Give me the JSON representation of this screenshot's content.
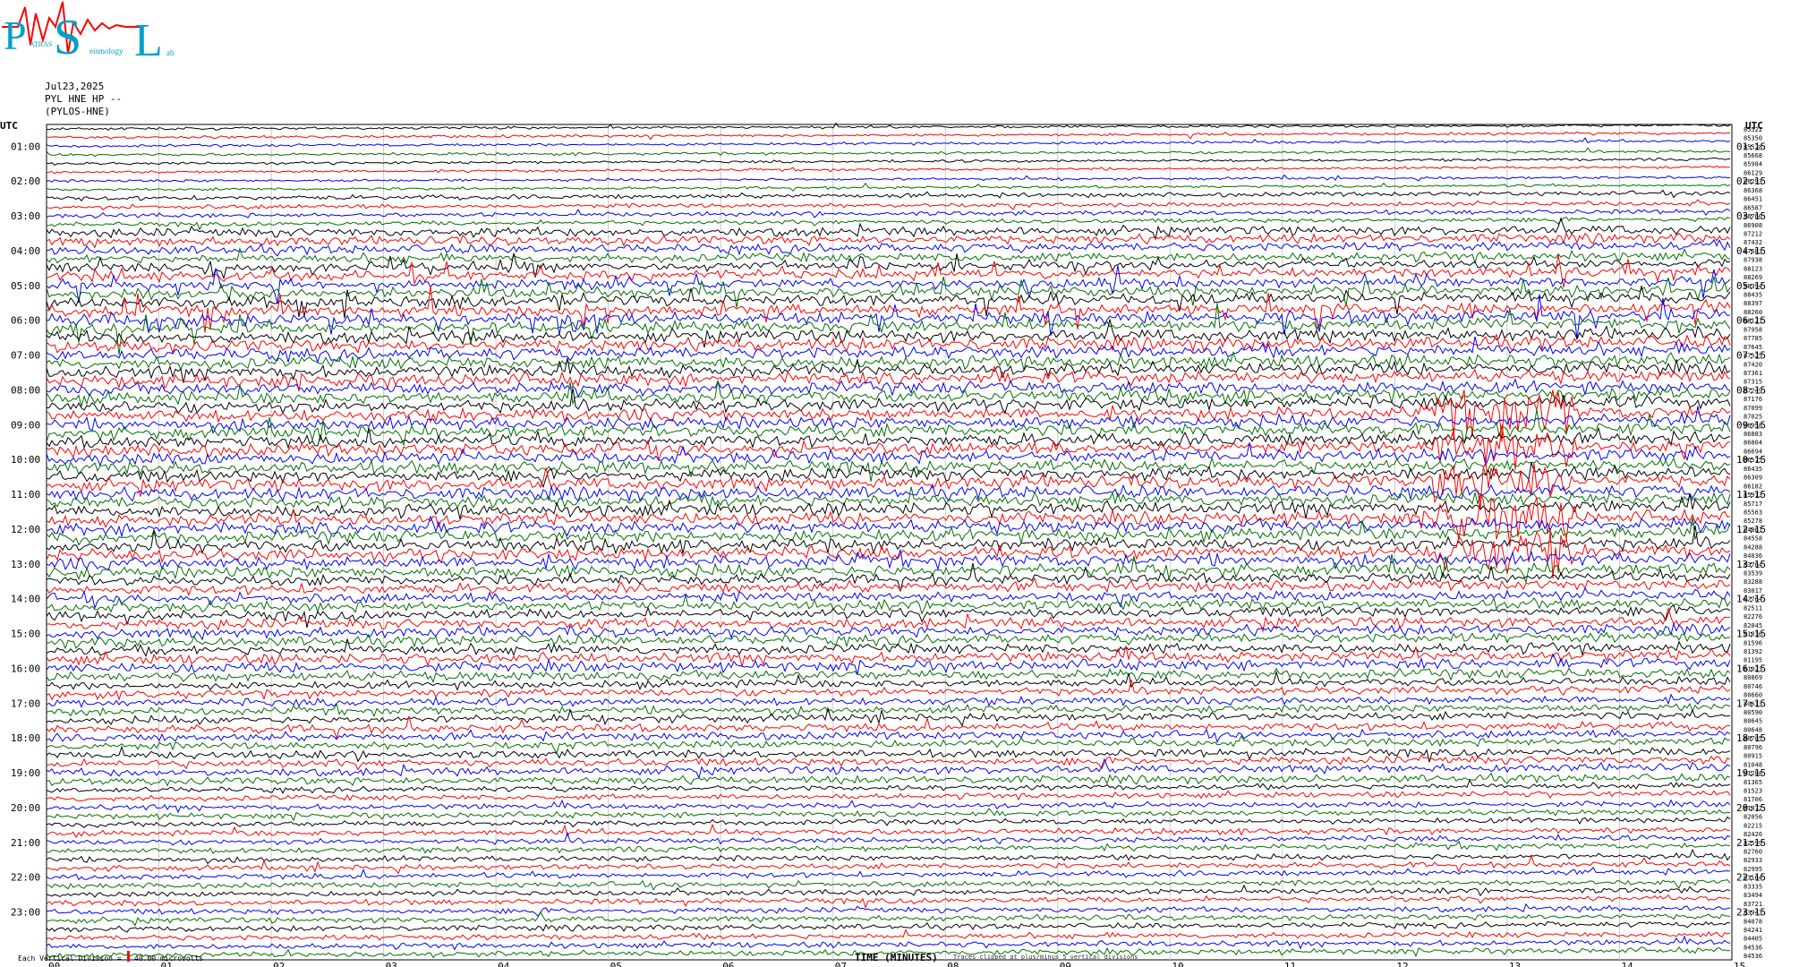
{
  "logo": {
    "text_p": "P",
    "text_s": "S",
    "text_l": "L",
    "subtext_1": "ATRAS",
    "subtext_2": "eismology",
    "subtext_3": "ab"
  },
  "header": {
    "date": "Jul23,2025",
    "channel": "PYL HNE HP --",
    "station": "(PYLOS-HNE)"
  },
  "axes": {
    "left_label": "UTC",
    "right_label": "UTC",
    "x_label": "TIME (MINUTES)",
    "x_ticks": [
      "00",
      "01",
      "02",
      "03",
      "04",
      "05",
      "06",
      "07",
      "08",
      "09",
      "10",
      "11",
      "12",
      "13",
      "14",
      "15"
    ],
    "left_hours": [
      "01:00",
      "02:00",
      "03:00",
      "04:00",
      "05:00",
      "06:00",
      "07:00",
      "08:00",
      "09:00",
      "10:00",
      "11:00",
      "12:00",
      "13:00",
      "14:00",
      "15:00",
      "16:00",
      "17:00",
      "18:00",
      "19:00",
      "20:00",
      "21:00",
      "22:00",
      "23:00"
    ],
    "right_hours": [
      "01:15",
      "02:15",
      "03:15",
      "04:15",
      "05:15",
      "06:15",
      "07:15",
      "08:15",
      "09:15",
      "10:15",
      "11:15",
      "12:15",
      "13:15",
      "14:15",
      "15:15",
      "16:15",
      "17:15",
      "18:15",
      "19:15",
      "20:15",
      "21:15",
      "22:15",
      "23:15"
    ]
  },
  "footer": {
    "scale": "Each Vertical Division =   40.00 microvolts",
    "note": "Traces clipped at plus/minus 5 vertical divisions"
  },
  "chart_data": {
    "type": "line",
    "title": "",
    "xlabel": "TIME (MINUTES)",
    "ylabel": "UTC",
    "xlim": [
      0,
      15
    ],
    "trace_count": 96,
    "minutes_per_trace": 15,
    "trace_colors": [
      "#000000",
      "#ff0000",
      "#0000ff",
      "#007000"
    ],
    "right_counts": [
      "85522",
      "85350",
      "85528",
      "85668",
      "85984",
      "86129",
      "86293",
      "86368",
      "86451",
      "86587",
      "86760",
      "86908",
      "87212",
      "87432",
      "87603",
      "87938",
      "88123",
      "88269",
      "88394",
      "88435",
      "88397",
      "88260",
      "88121",
      "87958",
      "87785",
      "87645",
      "87525",
      "87420",
      "87361",
      "87315",
      "87249",
      "87176",
      "87099",
      "87025",
      "86958",
      "86883",
      "86804",
      "86694",
      "86575",
      "86435",
      "86309",
      "86182",
      "85913",
      "85717",
      "85563",
      "85278",
      "84861",
      "84558",
      "84288",
      "84036",
      "83764",
      "83539",
      "83288",
      "83017",
      "82764",
      "82511",
      "82276",
      "82045",
      "81816",
      "81596",
      "81392",
      "81195",
      "81023",
      "80869",
      "80746",
      "80660",
      "80613",
      "80590",
      "80645",
      "80648",
      "80705",
      "80796",
      "80915",
      "81048",
      "81208",
      "81365",
      "81523",
      "81706",
      "81872",
      "82056",
      "82215",
      "82426",
      "82599",
      "82760",
      "82933",
      "82995",
      "83164",
      "83335",
      "83494",
      "83721",
      "83943",
      "84078",
      "84241",
      "84405",
      "84536",
      "84536"
    ]
  }
}
